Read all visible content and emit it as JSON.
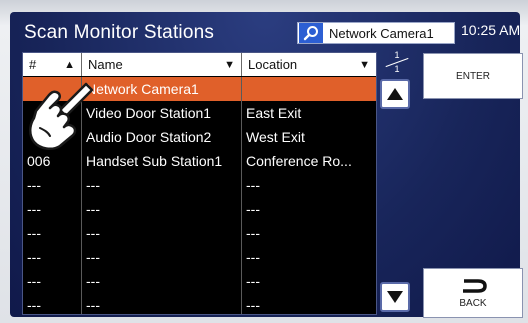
{
  "header": {
    "title": "Scan Monitor Stations",
    "search_value": "Network Camera1",
    "time": "10:25 AM"
  },
  "table": {
    "columns": [
      {
        "label": "#",
        "sort": "▲"
      },
      {
        "label": "Name",
        "sort": "▼"
      },
      {
        "label": "Location",
        "sort": "▼"
      }
    ],
    "rows": [
      {
        "num": "",
        "name": "Network Camera1",
        "location": "",
        "selected": true
      },
      {
        "num": "",
        "name": "Video Door Station1",
        "location": "East Exit"
      },
      {
        "num": "",
        "name": "Audio Door Station2",
        "location": "West Exit"
      },
      {
        "num": "006",
        "name": "Handset Sub Station1",
        "location": "Conference Ro..."
      },
      {
        "num": "---",
        "name": "---",
        "location": "---"
      },
      {
        "num": "---",
        "name": "---",
        "location": "---"
      },
      {
        "num": "---",
        "name": "---",
        "location": "---"
      },
      {
        "num": "---",
        "name": "---",
        "location": "---"
      },
      {
        "num": "---",
        "name": "---",
        "location": "---"
      },
      {
        "num": "---",
        "name": "---",
        "location": "---"
      }
    ]
  },
  "pagination": {
    "current": "1",
    "total": "1"
  },
  "buttons": {
    "enter": "ENTER",
    "back": "BACK"
  },
  "colors": {
    "selected_row": "#e0602a",
    "search_icon_bg": "#2d5fd3",
    "background": "#18255a"
  }
}
